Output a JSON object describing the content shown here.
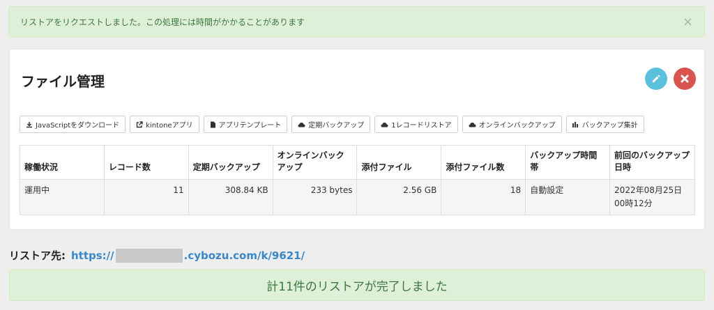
{
  "alert": {
    "message": "リストアをリクエストしました。この処理には時間がかかることがあります",
    "close": "×"
  },
  "panel": {
    "title": "ファイル管理",
    "toolbar": [
      {
        "icon": "download-icon",
        "label": "JavaScriptをダウンロード"
      },
      {
        "icon": "external-link-icon",
        "label": "kintoneアプリ"
      },
      {
        "icon": "file-icon",
        "label": "アプリテンプレート"
      },
      {
        "icon": "cloud-icon",
        "label": "定期バックアップ"
      },
      {
        "icon": "cloud-icon",
        "label": "1レコードリストア"
      },
      {
        "icon": "cloud-icon",
        "label": "オンラインバックアップ"
      },
      {
        "icon": "bar-chart-icon",
        "label": "バックアップ集計"
      }
    ],
    "table": {
      "headers": [
        "稼働状況",
        "レコード数",
        "定期バックアップ",
        "オンラインバックアップ",
        "添付ファイル",
        "添付ファイル数",
        "バックアップ時間帯",
        "前回のバックアップ日時"
      ],
      "row": [
        "運用中",
        "11",
        "308.84 KB",
        "233 bytes",
        "2.56 GB",
        "18",
        "自動設定",
        "2022年08月25日 00時12分"
      ]
    }
  },
  "restore": {
    "label": "リストア先:",
    "url_prefix": "https://",
    "url_suffix": ".cybozu.com/k/9621/"
  },
  "done": {
    "message": "計11件のリストアが完了しました"
  },
  "colors": {
    "success_bg": "#dff0d8",
    "success_text": "#3c763d",
    "info": "#5bc0de",
    "danger": "#d9534f",
    "link": "#3a87c8"
  }
}
